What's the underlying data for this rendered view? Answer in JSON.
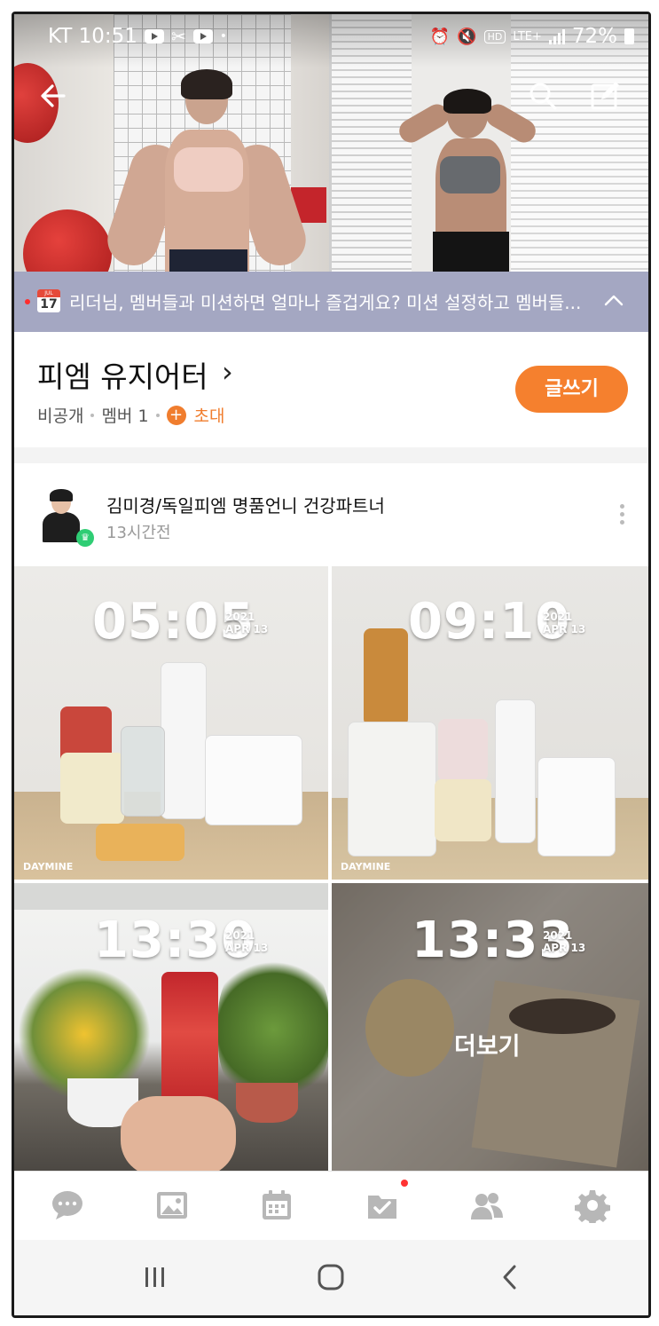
{
  "status_bar": {
    "carrier_time": "KT 10:51",
    "right_text": "72%",
    "network": "LTE+"
  },
  "banner": {
    "calendar_month": "JUL",
    "calendar_day": "17",
    "text": "리더님, 멤버들과 미션하면 얼마나 즐겁게요? 미션 설정하고 멤버들..."
  },
  "band": {
    "title": "피엠 유지어터",
    "privacy": "비공개",
    "members": "멤버 1",
    "invite": "초대",
    "write_button": "글쓰기"
  },
  "post": {
    "author": "김미경/독일피엠 명품언니 건강파트너",
    "time": "13시간전",
    "photos": [
      {
        "clock": "05:05",
        "year": "2021",
        "date": "APR 13",
        "watermark": "DAYMINE"
      },
      {
        "clock": "09:10",
        "year": "2021",
        "date": "APR 13",
        "watermark": "DAYMINE"
      },
      {
        "clock": "13:30",
        "year": "2021",
        "date": "APR 13"
      },
      {
        "clock": "13:33",
        "year": "2021",
        "date": "APR 13",
        "more_label": "더보기"
      }
    ]
  },
  "tabs": [
    "chat-icon",
    "photo-icon",
    "calendar-icon",
    "mission-icon",
    "members-icon",
    "settings-icon"
  ],
  "colors": {
    "accent": "#f5802e",
    "banner": "#a4a7c2",
    "notification": "#ff3333",
    "crown": "#2fcd74"
  }
}
